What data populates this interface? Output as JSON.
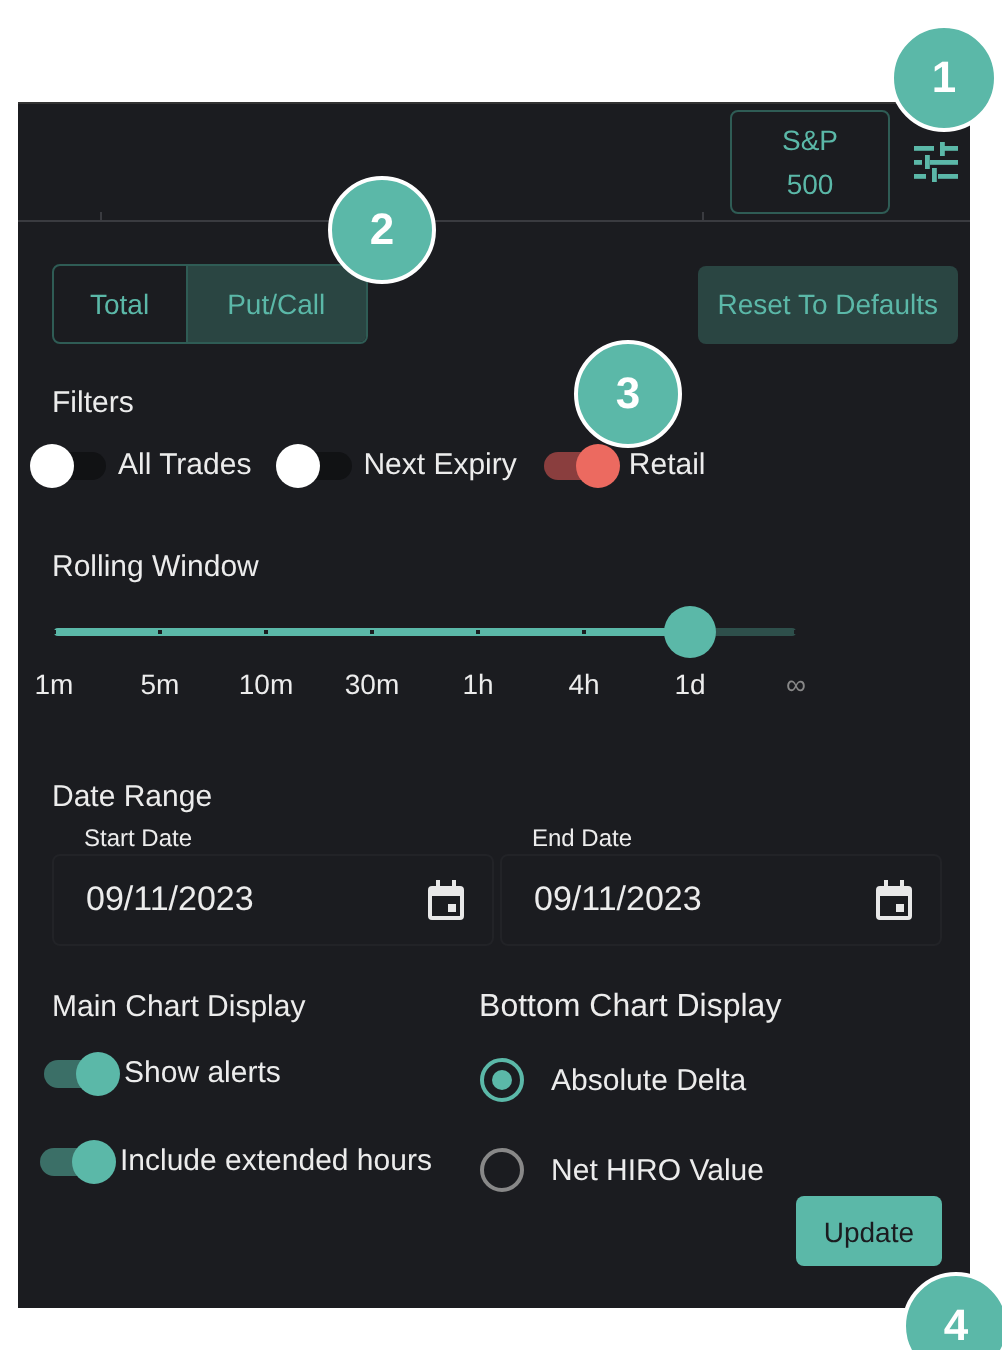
{
  "header": {
    "index_button": {
      "line1": "S&P",
      "line2": "500"
    }
  },
  "view_tabs": [
    {
      "label": "Total",
      "selected": false
    },
    {
      "label": "Put/Call",
      "selected": true
    }
  ],
  "reset_button": "Reset To Defaults",
  "filters": {
    "title": "Filters",
    "toggles": [
      {
        "label": "All Trades",
        "on": false
      },
      {
        "label": "Next Expiry",
        "on": false
      },
      {
        "label": "Retail",
        "on": true
      }
    ]
  },
  "rolling_window": {
    "title": "Rolling Window",
    "level": 0.857,
    "stops": [
      "1m",
      "5m",
      "10m",
      "30m",
      "1h",
      "4h",
      "1d",
      "∞"
    ]
  },
  "date_range": {
    "title": "Date Range",
    "fields": [
      {
        "label": "Start Date",
        "value": "09/11/2023"
      },
      {
        "label": "End Date",
        "value": "09/11/2023"
      }
    ]
  },
  "main_chart_display": {
    "title": "Main Chart Display",
    "toggles": [
      {
        "label": "Show alerts",
        "on": true
      },
      {
        "label": "Include extended hours",
        "on": true
      }
    ]
  },
  "bottom_chart_display": {
    "title": "Bottom Chart Display",
    "options": [
      {
        "label": "Absolute Delta",
        "selected": true
      },
      {
        "label": "Net HIRO Value",
        "selected": false
      }
    ]
  },
  "update_button": "Update",
  "callouts": [
    "1",
    "2",
    "3",
    "4"
  ]
}
